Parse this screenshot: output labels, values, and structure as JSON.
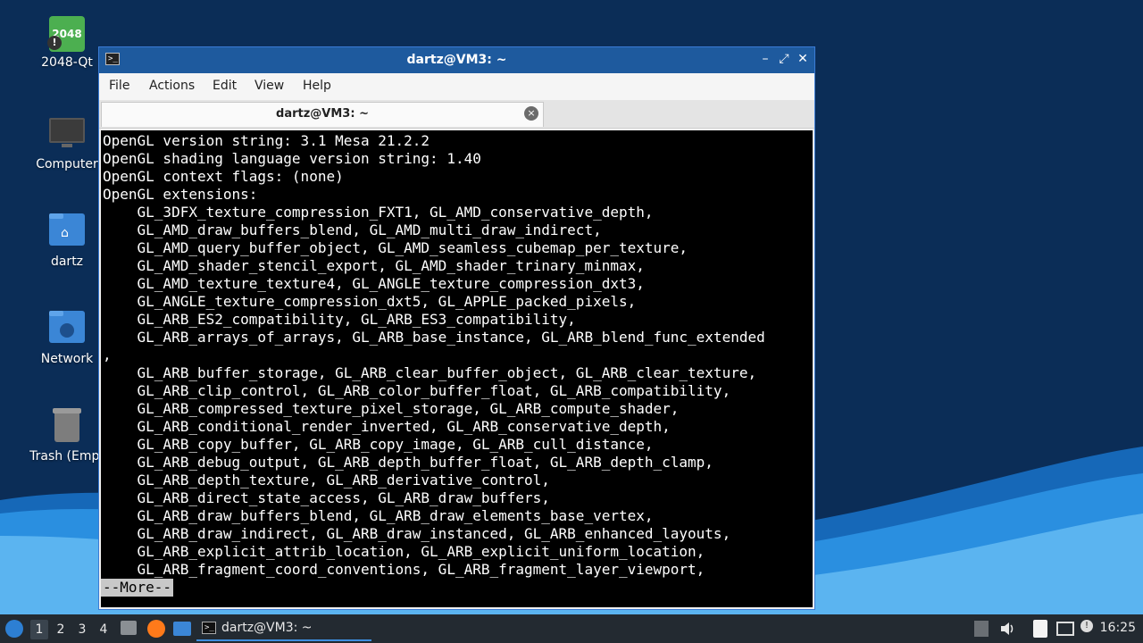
{
  "colors": {
    "desktop": "#0b2d57",
    "wave_light": "#2a8fe0",
    "titlebar": "#1e5a9e",
    "taskbar": "#232a31",
    "terminal_bg": "#000000",
    "terminal_fg": "#ffffff"
  },
  "desktop": {
    "icons": [
      {
        "label": "2048-Qt",
        "badge": "2048",
        "icon": "game-2048-icon"
      },
      {
        "label": "Computer",
        "icon": "computer-icon"
      },
      {
        "label": "dartz",
        "icon": "home-folder-icon"
      },
      {
        "label": "Network",
        "icon": "network-folder-icon"
      },
      {
        "label": "Trash (Empt",
        "icon": "trash-icon"
      }
    ]
  },
  "window": {
    "title": "dartz@VM3: ~",
    "controls": {
      "minimize": "–",
      "maximize": "⤢",
      "close": "✕"
    },
    "menu": [
      "File",
      "Actions",
      "Edit",
      "View",
      "Help"
    ],
    "tab": {
      "label": "dartz@VM3: ~",
      "close": "×"
    }
  },
  "terminal": {
    "lines": [
      "OpenGL version string: 3.1 Mesa 21.2.2",
      "OpenGL shading language version string: 1.40",
      "OpenGL context flags: (none)",
      "OpenGL extensions:",
      "    GL_3DFX_texture_compression_FXT1, GL_AMD_conservative_depth,",
      "    GL_AMD_draw_buffers_blend, GL_AMD_multi_draw_indirect,",
      "    GL_AMD_query_buffer_object, GL_AMD_seamless_cubemap_per_texture,",
      "    GL_AMD_shader_stencil_export, GL_AMD_shader_trinary_minmax,",
      "    GL_AMD_texture_texture4, GL_ANGLE_texture_compression_dxt3,",
      "    GL_ANGLE_texture_compression_dxt5, GL_APPLE_packed_pixels,",
      "    GL_ARB_ES2_compatibility, GL_ARB_ES3_compatibility,",
      "    GL_ARB_arrays_of_arrays, GL_ARB_base_instance, GL_ARB_blend_func_extended",
      ",",
      "    GL_ARB_buffer_storage, GL_ARB_clear_buffer_object, GL_ARB_clear_texture,",
      "    GL_ARB_clip_control, GL_ARB_color_buffer_float, GL_ARB_compatibility,",
      "    GL_ARB_compressed_texture_pixel_storage, GL_ARB_compute_shader,",
      "    GL_ARB_conditional_render_inverted, GL_ARB_conservative_depth,",
      "    GL_ARB_copy_buffer, GL_ARB_copy_image, GL_ARB_cull_distance,",
      "    GL_ARB_debug_output, GL_ARB_depth_buffer_float, GL_ARB_depth_clamp,",
      "    GL_ARB_depth_texture, GL_ARB_derivative_control,",
      "    GL_ARB_direct_state_access, GL_ARB_draw_buffers,",
      "    GL_ARB_draw_buffers_blend, GL_ARB_draw_elements_base_vertex,",
      "    GL_ARB_draw_indirect, GL_ARB_draw_instanced, GL_ARB_enhanced_layouts,",
      "    GL_ARB_explicit_attrib_location, GL_ARB_explicit_uniform_location,",
      "    GL_ARB_fragment_coord_conventions, GL_ARB_fragment_layer_viewport,"
    ],
    "pager_prompt": "--More--"
  },
  "taskbar": {
    "workspaces": [
      "1",
      "2",
      "3",
      "4"
    ],
    "active_workspace": "1",
    "task_label": "dartz@VM3: ~",
    "clock": "16:25"
  }
}
